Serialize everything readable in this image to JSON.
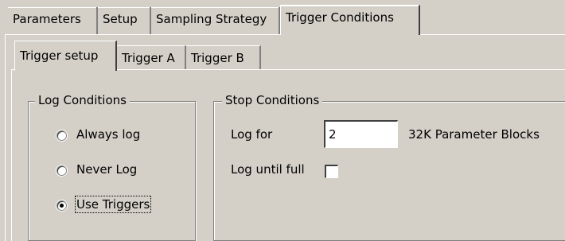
{
  "top_tabs": [
    {
      "label": "Parameters"
    },
    {
      "label": "Setup"
    },
    {
      "label": "Sampling Strategy"
    },
    {
      "label": "Trigger Conditions",
      "active": true
    }
  ],
  "sub_tabs": [
    {
      "label": "Trigger setup",
      "active": true
    },
    {
      "label": "Trigger A"
    },
    {
      "label": "Trigger B"
    }
  ],
  "log_conditions": {
    "title": "Log Conditions",
    "options": [
      {
        "label": "Always log",
        "selected": false
      },
      {
        "label": "Never Log",
        "selected": false
      },
      {
        "label": "Use Triggers",
        "selected": true
      }
    ]
  },
  "stop_conditions": {
    "title": "Stop Conditions",
    "log_for_label": "Log for",
    "log_for_value": "2",
    "log_for_unit": "32K Parameter Blocks",
    "log_until_full_label": "Log until full",
    "log_until_full_checked": false
  }
}
